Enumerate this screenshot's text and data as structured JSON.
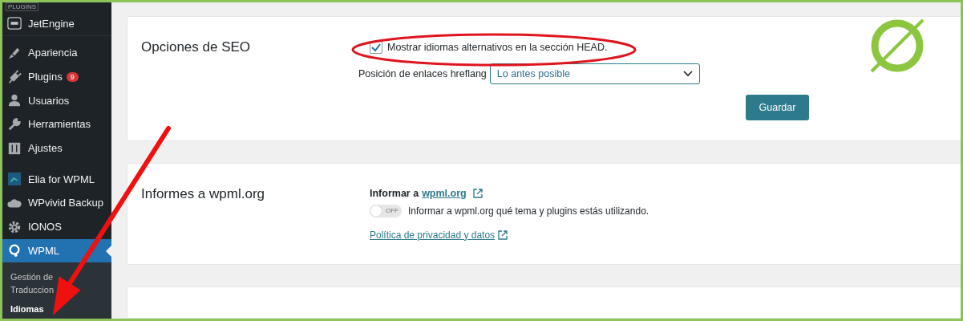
{
  "sidebar": {
    "section_label": "PLUGINS",
    "items": [
      {
        "label": "JetEngine",
        "selected": false
      },
      {
        "label": "Apariencia",
        "selected": false
      },
      {
        "label": "Plugins",
        "badge": "9",
        "selected": false
      },
      {
        "label": "Usuarios",
        "selected": false
      },
      {
        "label": "Herramientas",
        "selected": false
      },
      {
        "label": "Ajustes",
        "selected": false
      },
      {
        "label": "Elia for WPML",
        "selected": false
      },
      {
        "label": "WPvivid Backup",
        "selected": false
      },
      {
        "label": "IONOS",
        "selected": false
      },
      {
        "label": "WPML",
        "selected": true
      }
    ],
    "submenu": [
      {
        "label": "Gestión de Traduccion",
        "selected": false
      },
      {
        "label": "Idiomas",
        "selected": true
      }
    ]
  },
  "seo_card": {
    "title": "Opciones de SEO",
    "checkbox": {
      "label": "Mostrar idiomas alternativos en la sección HEAD.",
      "checked": true
    },
    "select": {
      "label": "Posición de enlaces hreflang",
      "value": "Lo antes posible"
    },
    "button": "Guardar"
  },
  "report_card": {
    "title": "Informes a wpml.org",
    "heading": "Informar a",
    "heading_link": "wpml.org",
    "toggle": {
      "on": false,
      "text": "OFF",
      "label": "Informar a wpml.org qué tema y plugins estás utilizando."
    },
    "privacy_link": "Política de privacidad y datos"
  }
}
